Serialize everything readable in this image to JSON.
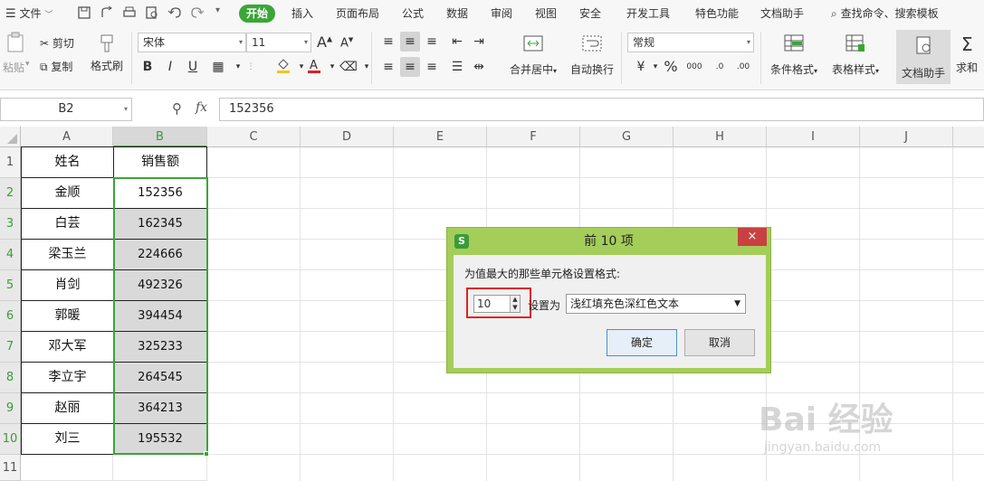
{
  "menubar": {
    "file_label": "文件",
    "tabs": [
      "开始",
      "插入",
      "页面布局",
      "公式",
      "数据",
      "审阅",
      "视图",
      "安全",
      "开发工具",
      "特色功能",
      "文档助手"
    ],
    "search_label": "查找命令、搜索模板"
  },
  "ribbon": {
    "paste": "粘贴",
    "cut": "剪切",
    "copy": "复制",
    "format_painter": "格式刷",
    "font_name": "宋体",
    "font_size": "11",
    "merge_center": "合并居中",
    "wrap_text": "自动换行",
    "number_format": "常规",
    "conditional_format": "条件格式",
    "table_style": "表格样式",
    "doc_helper": "文档助手",
    "sum": "求和",
    "bold": "B",
    "italic": "I",
    "underline": "U",
    "percent": "%",
    "inc_font": "A",
    "dec_font": "A"
  },
  "formulabar": {
    "cell_ref": "B2",
    "fx": "fx",
    "value": "152356"
  },
  "grid": {
    "columns": [
      "A",
      "B",
      "C",
      "D",
      "E",
      "F",
      "G",
      "H",
      "I",
      "J"
    ],
    "rows": [
      "1",
      "2",
      "3",
      "4",
      "5",
      "6",
      "7",
      "8",
      "9",
      "10",
      "11"
    ],
    "header": [
      "姓名",
      "销售额"
    ],
    "data": [
      [
        "金顺",
        "152356"
      ],
      [
        "白芸",
        "162345"
      ],
      [
        "梁玉兰",
        "224666"
      ],
      [
        "肖剑",
        "492326"
      ],
      [
        "郭暖",
        "394454"
      ],
      [
        "邓大军",
        "325233"
      ],
      [
        "李立宇",
        "264545"
      ],
      [
        "赵丽",
        "364213"
      ],
      [
        "刘三",
        "195532"
      ]
    ]
  },
  "dialog": {
    "title": "前 10 项",
    "icon_letter": "S",
    "close": "×",
    "description": "为值最大的那些单元格设置格式:",
    "count": "10",
    "set_as_label": "设置为",
    "format_option": "浅红填充色深红色文本",
    "ok": "确定",
    "cancel": "取消"
  },
  "watermark": {
    "main": "Bai 经验",
    "sub": "jingyan.baidu.com"
  },
  "colors": {
    "accent_green": "#3ba537",
    "dialog_frame": "#a4cd5a",
    "close_red": "#c94040",
    "highlight_red": "#e02020"
  }
}
